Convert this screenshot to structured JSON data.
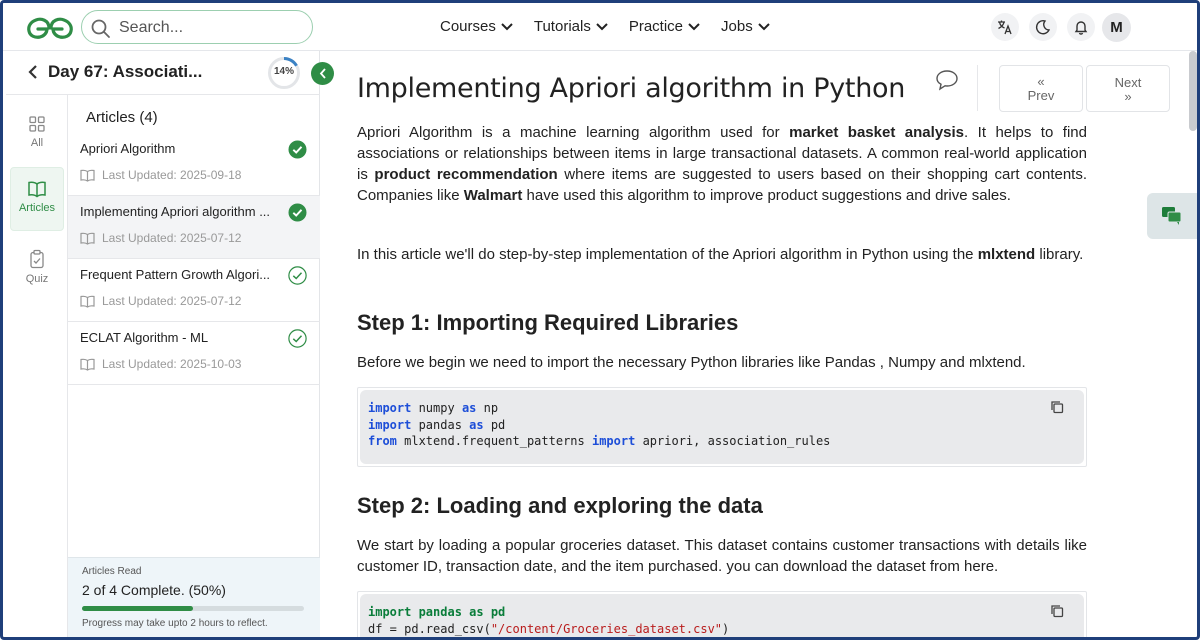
{
  "colors": {
    "brand_green": "#2f8d46",
    "frame": "#1f3f7a",
    "code_keyword": "#1d4ed8"
  },
  "topbar": {
    "search_placeholder": "Search...",
    "menu": [
      {
        "label": "Courses"
      },
      {
        "label": "Tutorials"
      },
      {
        "label": "Practice"
      },
      {
        "label": "Jobs"
      }
    ],
    "avatar_initial": "M"
  },
  "sidebar": {
    "day_title": "Day 67: Associati...",
    "progress_percent": "14%",
    "rail": [
      {
        "label": "All",
        "icon": "grid-icon"
      },
      {
        "label": "Articles",
        "icon": "book-icon"
      },
      {
        "label": "Quiz",
        "icon": "clipboard-icon"
      }
    ],
    "articles_heading": "Articles (4)",
    "articles": [
      {
        "name": "Apriori Algorithm",
        "updated": "Last Updated: 2025-09-18",
        "status": "completed"
      },
      {
        "name": "Implementing Apriori algorithm ...",
        "updated": "Last Updated: 2025-07-12",
        "status": "completed"
      },
      {
        "name": "Frequent Pattern Growth Algori...",
        "updated": "Last Updated: 2025-07-12",
        "status": "pending"
      },
      {
        "name": "ECLAT Algorithm - ML",
        "updated": "Last Updated: 2025-10-03",
        "status": "pending"
      }
    ],
    "read_label": "Articles Read",
    "read_status": "2 of 4 Complete. (50%)",
    "read_fraction": 0.5,
    "read_note": "Progress may take upto 2 hours to reflect."
  },
  "article": {
    "title": "Implementing Apriori algorithm in Python",
    "prev_label": "Prev",
    "next_label": "Next",
    "p1": {
      "a": "Apriori Algorithm is a machine learning algorithm used for ",
      "b1": "market basket analysis",
      "c": ". It helps to find associations or relationships between items in large transactional datasets. A common real-world application is ",
      "b2": "product recommendation",
      "d": " where items are suggested to users based on their shopping cart contents. Companies like ",
      "b3": "Walmart",
      "e": " have used this algorithm to improve product suggestions and drive sales."
    },
    "p2": {
      "a": "In this article we'll do step-by-step implementation of the Apriori algorithm in Python using the ",
      "b": "mlxtend",
      "c": " library."
    },
    "step1_heading": "Step 1: Importing Required Libraries",
    "step1_text": "Before we begin we need to import the necessary Python libraries like Pandas , Numpy and mlxtend.",
    "code1": {
      "l1a": "import",
      "l1b": " numpy ",
      "l1c": "as",
      "l1d": " np",
      "l2a": "import",
      "l2b": " pandas ",
      "l2c": "as",
      "l2d": " pd",
      "l3a": "from",
      "l3b": " mlxtend.frequent_patterns ",
      "l3c": "import",
      "l3d": " apriori, association_rules"
    },
    "step2_heading": "Step 2: Loading and exploring the data",
    "step2_text": "We start by loading a popular groceries dataset. This dataset contains customer transactions with details like customer ID, transaction date, and the item purchased. you can download the dataset from here.",
    "code2": {
      "l1a": "import",
      "l1b": " pandas ",
      "l1c": "as",
      "l1d": " pd",
      "l2a": "df = pd.read_csv(",
      "l2b": "\"/content/Groceries_dataset.csv\"",
      "l2c": ")"
    }
  }
}
